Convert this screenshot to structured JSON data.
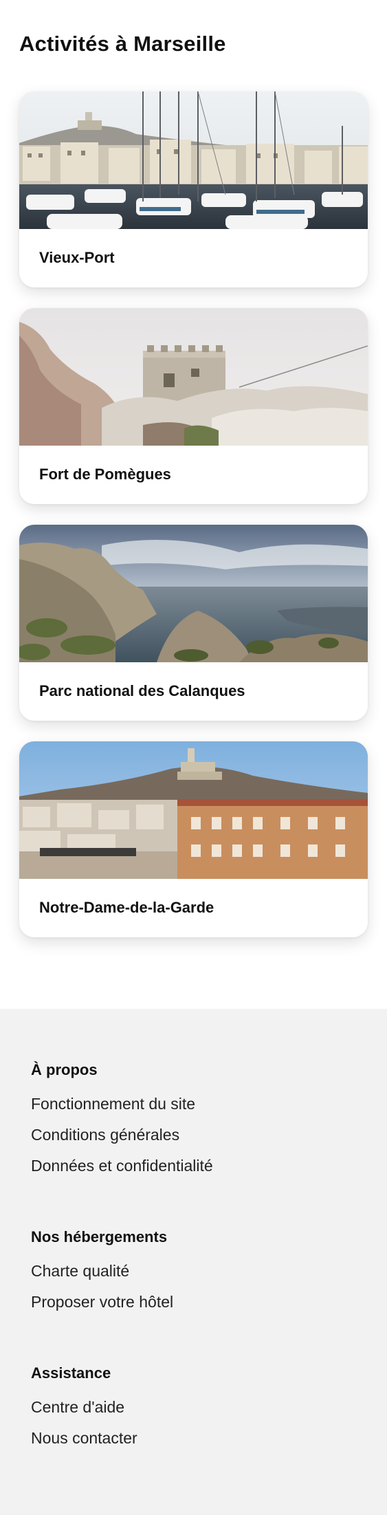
{
  "page": {
    "title": "Activités à Marseille"
  },
  "activities": [
    {
      "label": "Vieux-Port",
      "image": "old-port-marina-photo"
    },
    {
      "label": "Fort de Pomègues",
      "image": "fort-on-rocks-photo"
    },
    {
      "label": "Parc national des Calanques",
      "image": "calanques-cliffs-sea-photo"
    },
    {
      "label": "Notre-Dame-de-la-Garde",
      "image": "basilica-on-hill-city-photo"
    }
  ],
  "footer": {
    "sections": [
      {
        "heading": "À propos",
        "links": [
          "Fonctionnement du site",
          "Conditions générales",
          "Données et confidentialité"
        ]
      },
      {
        "heading": "Nos hébergements",
        "links": [
          "Charte qualité",
          "Proposer votre hôtel"
        ]
      },
      {
        "heading": "Assistance",
        "links": [
          "Centre d'aide",
          "Nous contacter"
        ]
      }
    ]
  },
  "colors": {
    "background": "#ffffff",
    "footer_background": "#f2f2f2",
    "text": "#111111"
  }
}
